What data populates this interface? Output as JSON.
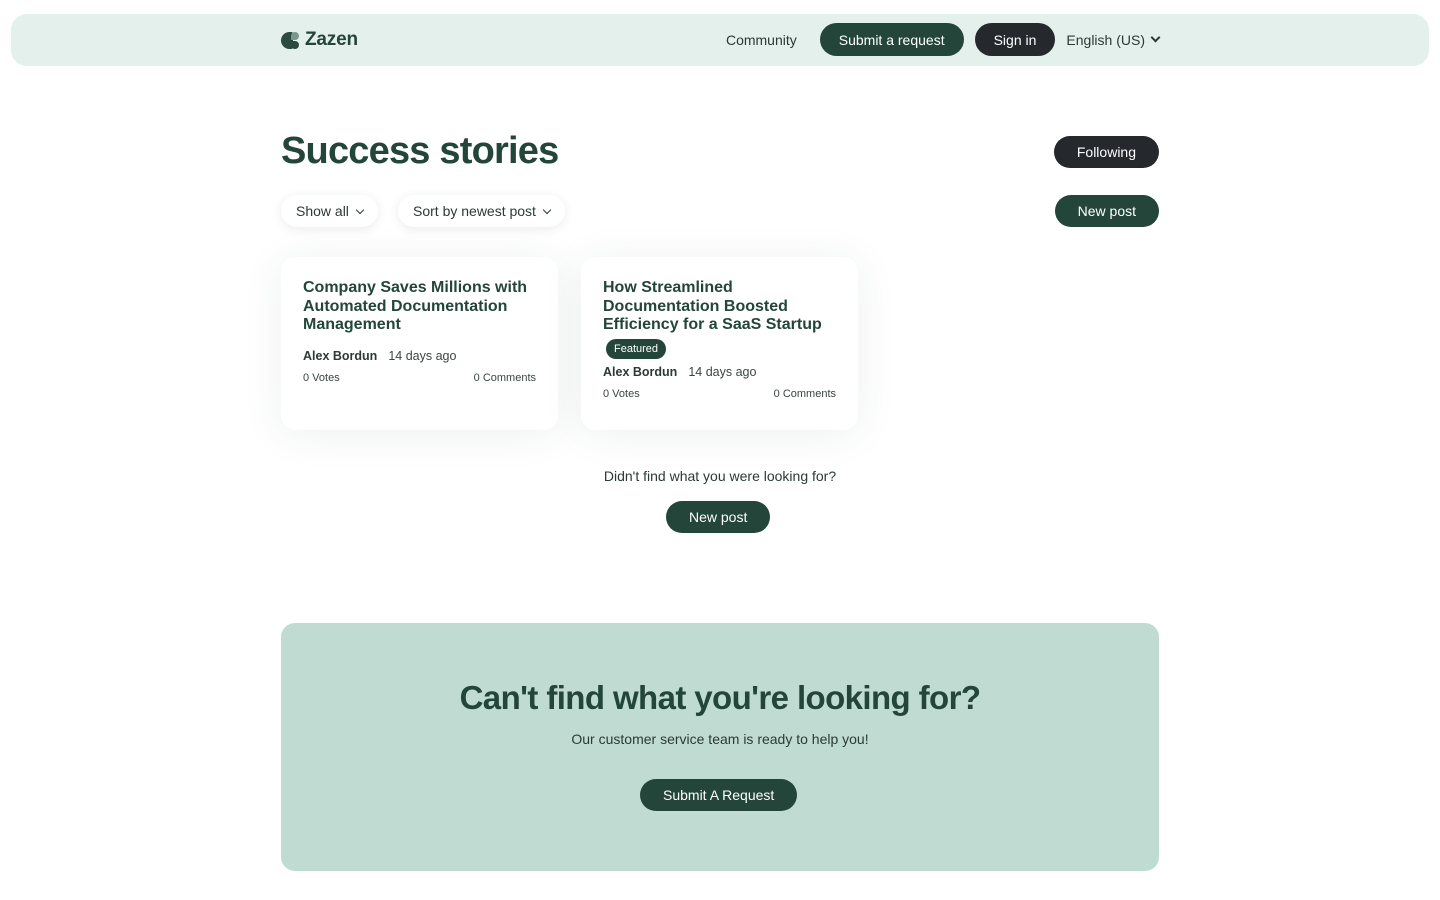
{
  "header": {
    "brand": "Zazen",
    "nav": {
      "community": "Community",
      "submit_request": "Submit a request",
      "sign_in": "Sign in",
      "language": "English (US)"
    }
  },
  "main": {
    "title": "Success stories",
    "following_label": "Following",
    "new_post_label": "New post",
    "filters": {
      "show": "Show all",
      "sort": "Sort by newest post"
    },
    "posts": [
      {
        "title": "Company Saves Millions with Automated Documentation Management",
        "author": "Alex Bordun",
        "time": "14 days ago",
        "votes": "0  Votes",
        "comments": "0  Comments"
      },
      {
        "title": "How Streamlined Documentation Boosted Efficiency for a SaaS Startup",
        "badge": "Featured",
        "author": "Alex Bordun",
        "time": "14 days ago",
        "votes": "0  Votes",
        "comments": "0  Comments"
      }
    ],
    "didnt_find": "Didn't find what you were looking for?",
    "new_post_bottom": "New post"
  },
  "cta": {
    "title": "Can't find what you're looking for?",
    "subtitle": "Our customer service team is ready to help you!",
    "button": "Submit A Request"
  },
  "colors": {
    "header_bg": "#e4f0eb",
    "primary": "#23453a",
    "dark": "#25282c",
    "cta_bg": "#c0dbd2"
  }
}
